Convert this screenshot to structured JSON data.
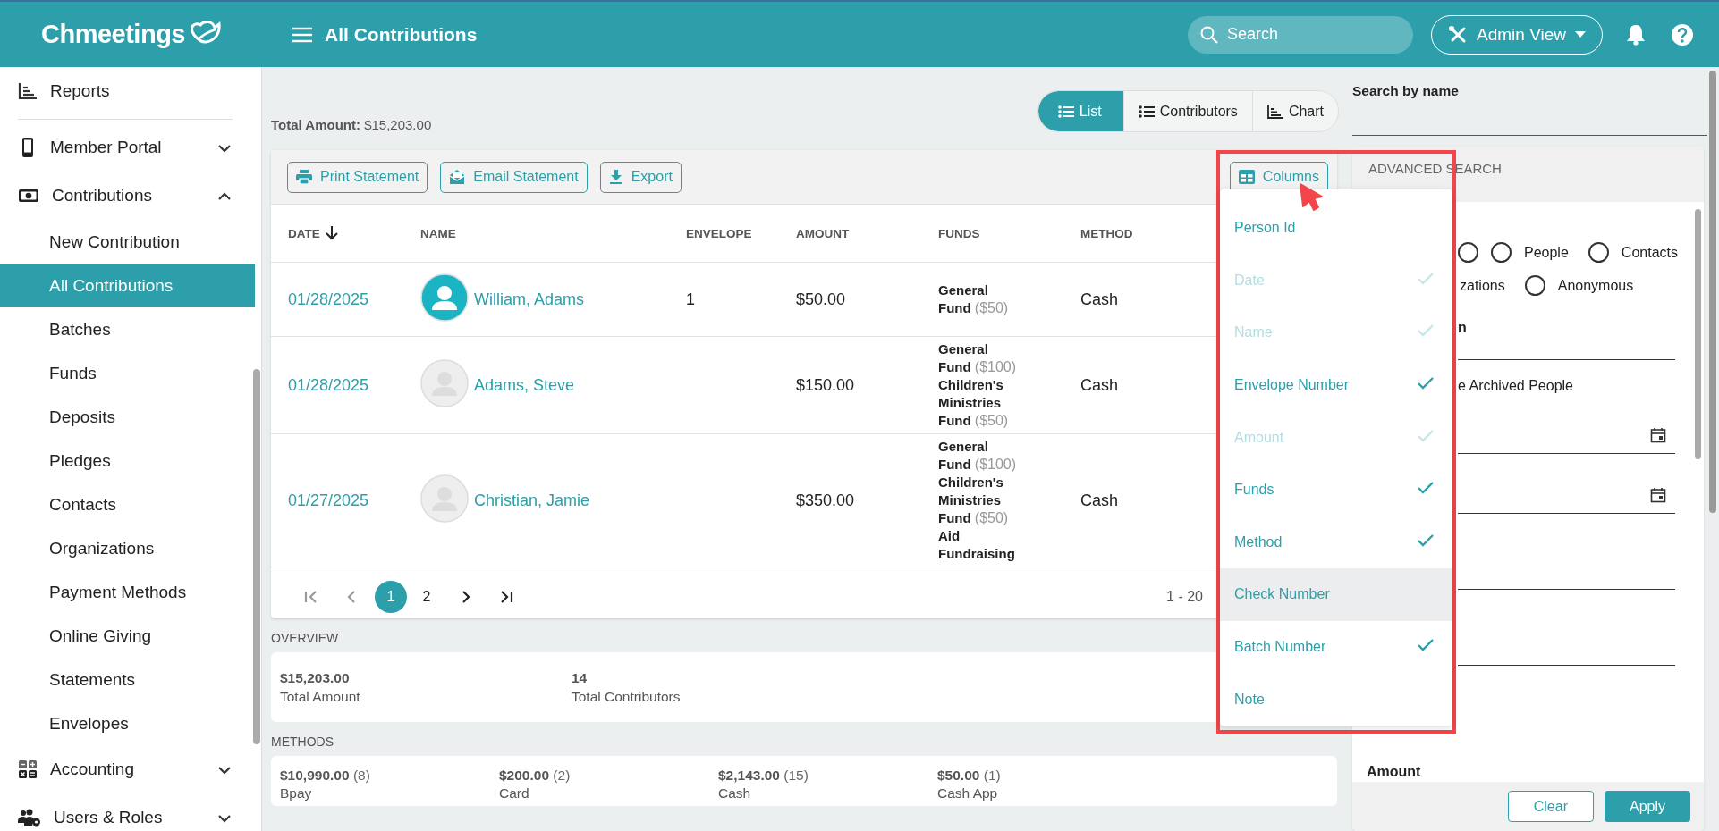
{
  "header": {
    "logo": "Chmeetings",
    "title": "All Contributions",
    "search": {
      "placeholder": "Search"
    },
    "view_button": "Admin View"
  },
  "sidebar": {
    "items": [
      {
        "label": "Reports",
        "selected": false
      },
      {
        "label": "Member Portal",
        "selected": false,
        "expanded": false
      },
      {
        "label": "Contributions",
        "selected": false,
        "expanded": true,
        "children": [
          {
            "label": "New Contribution",
            "selected": false
          },
          {
            "label": "All Contributions",
            "selected": true
          },
          {
            "label": "Batches",
            "selected": false
          },
          {
            "label": "Funds",
            "selected": false
          },
          {
            "label": "Deposits",
            "selected": false
          },
          {
            "label": "Pledges",
            "selected": false
          },
          {
            "label": "Contacts",
            "selected": false
          },
          {
            "label": "Organizations",
            "selected": false
          },
          {
            "label": "Payment Methods",
            "selected": false
          },
          {
            "label": "Online Giving",
            "selected": false
          },
          {
            "label": "Statements",
            "selected": false
          },
          {
            "label": "Envelopes",
            "selected": false
          }
        ]
      },
      {
        "label": "Accounting",
        "selected": false,
        "expanded": false
      },
      {
        "label": "Users & Roles",
        "selected": false,
        "expanded": false
      }
    ]
  },
  "summary": {
    "label": "Total Amount:",
    "value": "$15,203.00"
  },
  "view_tabs": [
    {
      "label": "List",
      "selected": true
    },
    {
      "label": "Contributors",
      "selected": false
    },
    {
      "label": "Chart",
      "selected": false
    }
  ],
  "toolbar": {
    "buttons": [
      "Print Statement",
      "Email Statement",
      "Export"
    ],
    "columns_button": "Columns"
  },
  "table": {
    "columns": [
      {
        "label": "DATE",
        "sorted": true
      },
      {
        "label": "NAME",
        "sorted": false
      },
      {
        "label": "ENVELOPE",
        "sorted": false
      },
      {
        "label": "AMOUNT",
        "sorted": false
      },
      {
        "label": "FUNDS",
        "sorted": false
      },
      {
        "label": "METHOD",
        "sorted": false
      }
    ],
    "rows": [
      {
        "date": "01/28/2025",
        "name": "William, Adams",
        "photo": true,
        "envelope": "1",
        "amount": "$50.00",
        "funds": [
          {
            "name": "General Fund",
            "amount": "($50)"
          }
        ],
        "method": "Cash"
      },
      {
        "date": "01/28/2025",
        "name": "Adams, Steve",
        "photo": false,
        "amount": "$150.00",
        "funds": [
          {
            "name": "General Fund",
            "amount": "($100)"
          },
          {
            "name": "Children's Ministries Fund",
            "amount": "($50)"
          }
        ],
        "method": "Cash"
      },
      {
        "date": "01/27/2025",
        "name": "Christian, Jamie",
        "photo": false,
        "amount": "$350.00",
        "funds": [
          {
            "name": "General Fund",
            "amount": "($100)"
          },
          {
            "name": "Children's Ministries Fund",
            "amount": "($50)"
          },
          {
            "name": "Aid Fundraising"
          }
        ],
        "method": "Cash"
      }
    ]
  },
  "pagination": {
    "pages": [
      {
        "label": "1",
        "selected": true
      },
      {
        "label": "2",
        "selected": false
      }
    ],
    "range": "1 - 20"
  },
  "columns_menu": [
    {
      "label": "Person Id",
      "checked": false,
      "disabled": false,
      "highlighted": false
    },
    {
      "label": "Date",
      "checked": true,
      "disabled": true,
      "highlighted": false
    },
    {
      "label": "Name",
      "checked": true,
      "disabled": true,
      "highlighted": false
    },
    {
      "label": "Envelope Number",
      "checked": true,
      "disabled": false,
      "highlighted": false
    },
    {
      "label": "Amount",
      "checked": true,
      "disabled": true,
      "highlighted": false
    },
    {
      "label": "Funds",
      "checked": true,
      "disabled": false,
      "highlighted": false
    },
    {
      "label": "Method",
      "checked": true,
      "disabled": false,
      "highlighted": false
    },
    {
      "label": "Check Number",
      "checked": false,
      "disabled": false,
      "highlighted": true
    },
    {
      "label": "Batch Number",
      "checked": true,
      "disabled": false,
      "highlighted": false
    },
    {
      "label": "Note",
      "checked": false,
      "disabled": false,
      "highlighted": false
    }
  ],
  "overview": {
    "title": "OVERVIEW",
    "stats": [
      {
        "value": "$15,203.00",
        "label": "Total Amount"
      },
      {
        "value": "14",
        "label": "Total Contributors"
      }
    ]
  },
  "methods": {
    "title": "METHODS",
    "items": [
      {
        "amount": "$10,990.00",
        "count": "(8)",
        "label": "Bpay"
      },
      {
        "amount": "$200.00",
        "count": "(2)",
        "label": "Card"
      },
      {
        "amount": "$2,143.00",
        "count": "(15)",
        "label": "Cash"
      },
      {
        "amount": "$50.00",
        "count": "(1)",
        "label": "Cash App"
      }
    ]
  },
  "search_panel": {
    "title": "Search by name",
    "advanced_title": "ADVANCED SEARCH",
    "radios": [
      {
        "kind": "bare",
        "selected": false
      },
      {
        "kind": "radio",
        "label": "People",
        "selected": false
      },
      {
        "kind": "radio",
        "label": "Contacts",
        "selected": false
      },
      {
        "kind": "cut",
        "label": "zations"
      },
      {
        "kind": "radio",
        "label": "Anonymous",
        "selected": false
      }
    ],
    "field_label": "n",
    "checkbox_label": "e Archived People",
    "amount_label": "Amount",
    "buttons": [
      "Clear",
      "Apply"
    ]
  }
}
